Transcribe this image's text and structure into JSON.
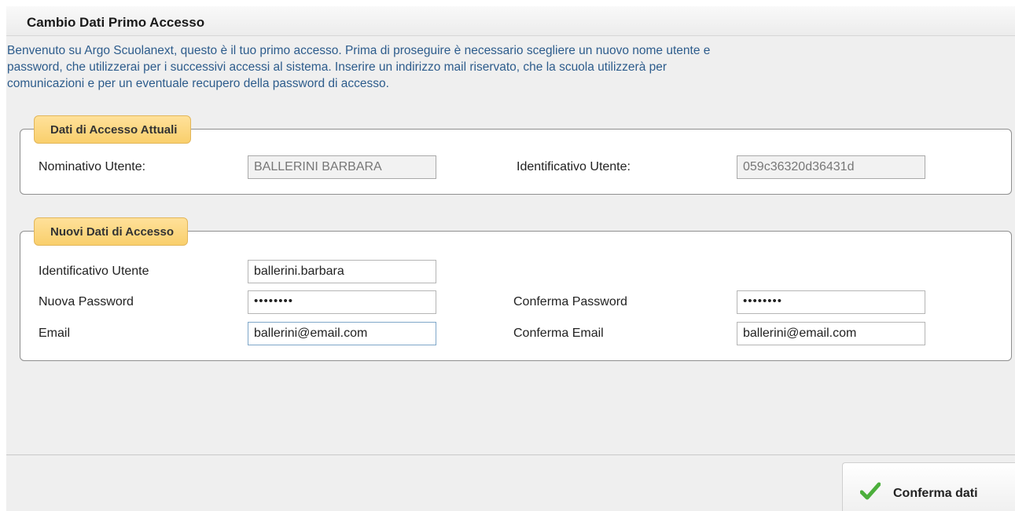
{
  "dialog": {
    "title": "Cambio Dati Primo Accesso",
    "intro_lines": [
      "Benvenuto su Argo Scuolanext, questo è il tuo primo accesso. Prima di proseguire è necessario scegliere un nuovo nome utente e",
      "password, che utilizzerai per i successivi accessi al sistema. Inserire un indirizzo mail riservato, che la scuola utilizzerà per",
      "comunicazioni e per un eventuale recupero della password di accesso."
    ]
  },
  "current_access": {
    "legend": "Dati di Accesso Attuali",
    "name_label": "Nominativo Utente:",
    "name_value": "BALLERINI BARBARA",
    "id_label": "Identificativo Utente:",
    "id_value": "059c36320d36431d"
  },
  "new_access": {
    "legend": "Nuovi Dati di Accesso",
    "user_id_label": "Identificativo Utente",
    "user_id_value": "ballerini.barbara",
    "password_label": "Nuova Password",
    "password_value": "••••••••",
    "confirm_password_label": "Conferma Password",
    "confirm_password_value": "••••••••",
    "email_label": "Email",
    "email_value": "ballerini@email.com",
    "confirm_email_label": "Conferma Email",
    "confirm_email_value": "ballerini@email.com"
  },
  "footer": {
    "confirm_button_label": "Conferma dati",
    "confirm_icon": "checkmark-icon",
    "confirm_icon_color": "#4caf3c"
  },
  "colors": {
    "intro_text": "#2d5c8c",
    "legend_bg": "#f9cf6c"
  }
}
